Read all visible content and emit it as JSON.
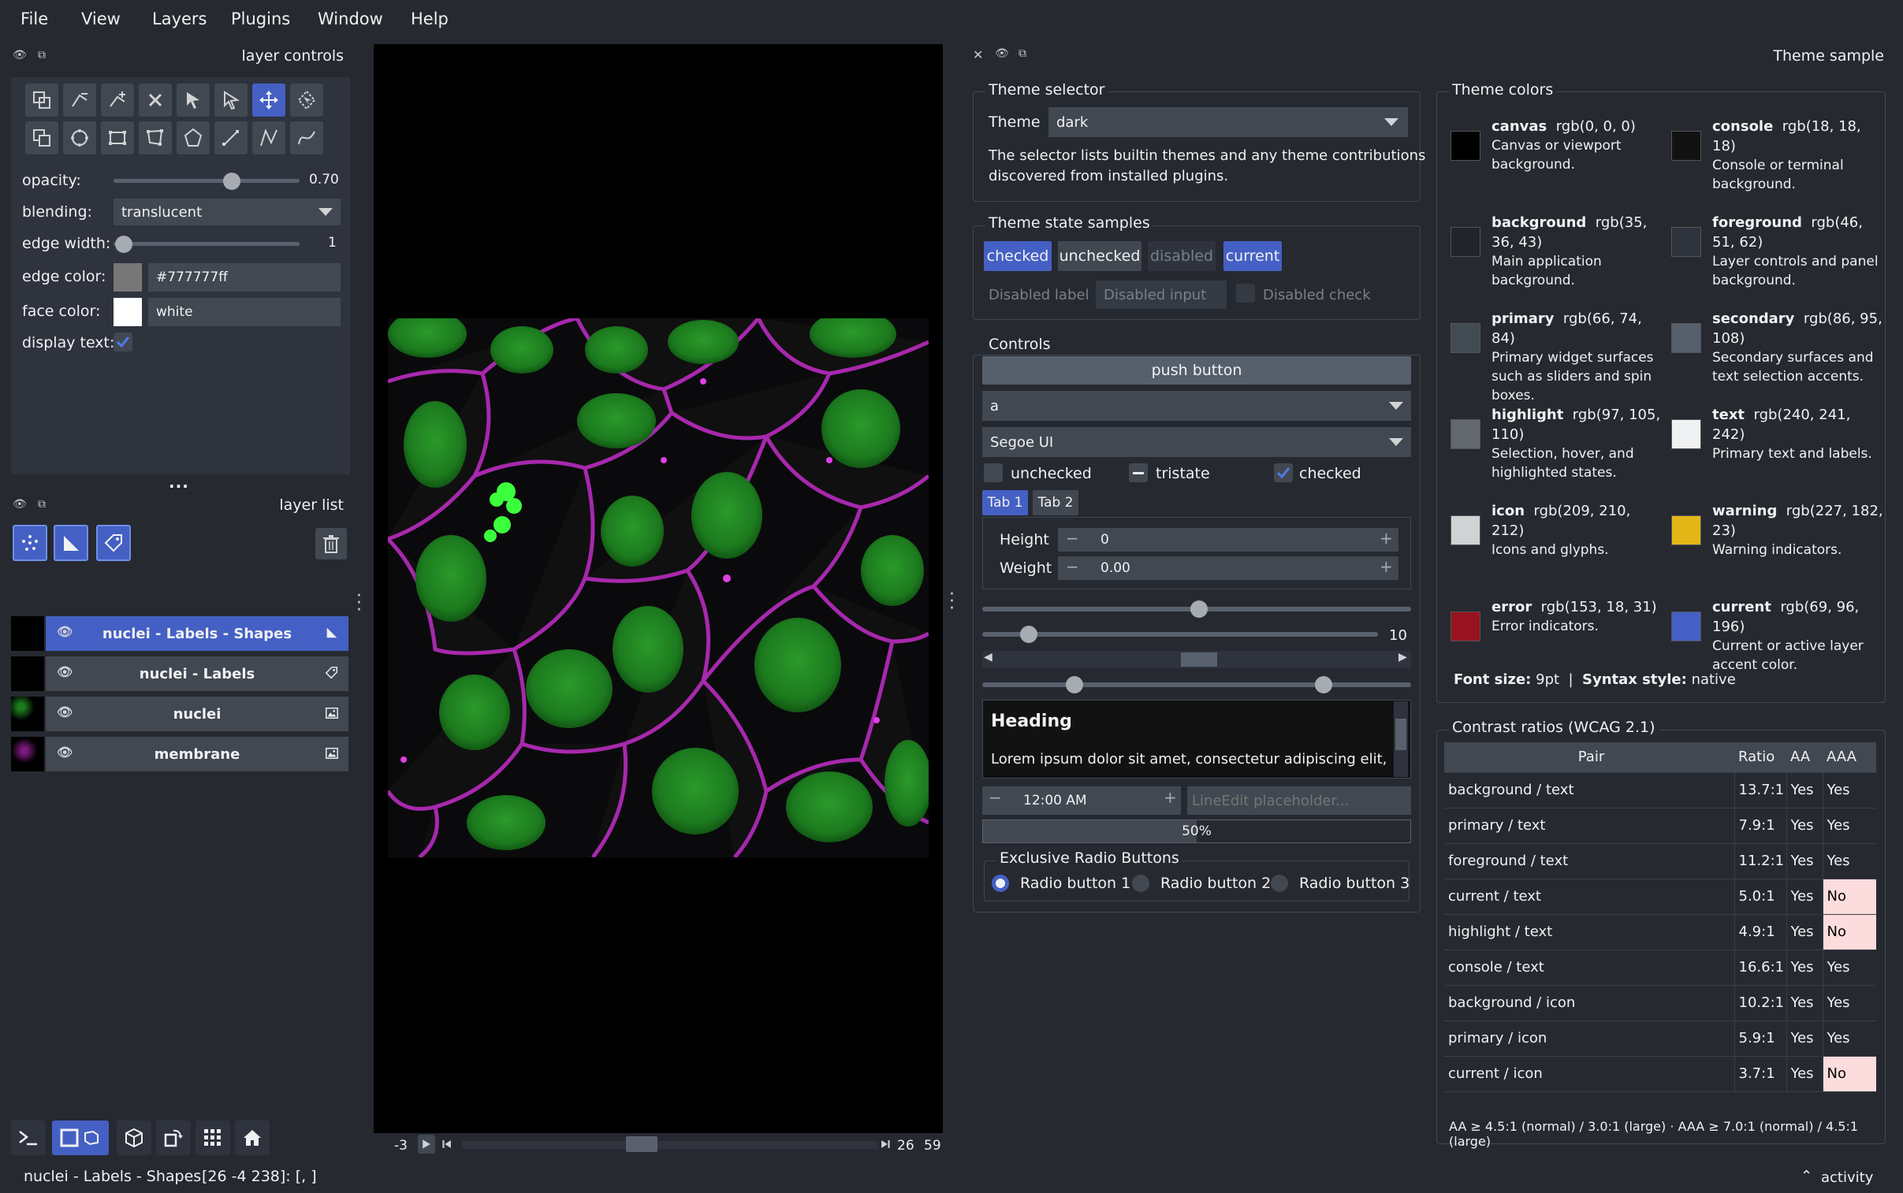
{
  "menu": {
    "file": "File",
    "view": "View",
    "layers": "Layers",
    "plugins": "Plugins",
    "window": "Window",
    "help": "Help"
  },
  "layer_controls": {
    "title": "layer controls",
    "opacity_label": "opacity:",
    "opacity_value": "0.70",
    "opacity": 0.7,
    "blending_label": "blending:",
    "blending_value": "translucent",
    "edge_width_label": "edge width:",
    "edge_width_value": "1",
    "edge_color_label": "edge color:",
    "edge_color_value": "#777777ff",
    "face_color_label": "face color:",
    "face_color_value": "white",
    "display_text_label": "display text:",
    "display_text_checked": true,
    "more": "..."
  },
  "layer_list": {
    "title": "layer list",
    "layers": [
      {
        "name": "nuclei - Labels - Shapes",
        "selected": true,
        "icon": "shapes-icon"
      },
      {
        "name": "nuclei - Labels",
        "selected": false,
        "icon": "labels-icon"
      },
      {
        "name": "nuclei",
        "selected": false,
        "icon": "image-icon"
      },
      {
        "name": "membrane",
        "selected": false,
        "icon": "image-icon"
      }
    ]
  },
  "dims": {
    "left": "-3",
    "frame": "26",
    "total": "59"
  },
  "theme_panel": {
    "title": "Theme sample"
  },
  "theme_selector": {
    "title": "Theme selector",
    "label": "Theme",
    "value": "dark",
    "desc_line1": "The selector lists builtin themes and any theme contributions",
    "desc_line2": "discovered from installed plugins."
  },
  "state_samples": {
    "title": "Theme state samples",
    "checked": "checked",
    "unchecked": "unchecked",
    "disabled": "disabled",
    "current": "current",
    "disabled_label": "Disabled label",
    "disabled_input": "Disabled input",
    "disabled_check": "Disabled check"
  },
  "controls": {
    "title": "Controls",
    "push_button": "push button",
    "combo_value": "a",
    "font_value": "Segoe UI",
    "cb_unchecked": "unchecked",
    "cb_tristate": "tristate",
    "cb_checked": "checked",
    "tab1": "Tab 1",
    "tab2": "Tab 2",
    "height_label": "Height",
    "height_value": "0",
    "weight_label": "Weight",
    "weight_value": "0.00",
    "slider_value": "10",
    "heading": "Heading",
    "lorem": "Lorem ipsum dolor sit amet, consectetur adipiscing elit,",
    "time": "12:00 AM",
    "lineedit_placeholder": "LineEdit placeholder...",
    "progress_text": "50%",
    "progress": 0.5,
    "radio_title": "Exclusive Radio Buttons",
    "radio1": "Radio button 1",
    "radio2": "Radio button 2",
    "radio3": "Radio button 3"
  },
  "theme_colors": {
    "title": "Theme colors",
    "items": [
      {
        "name": "canvas",
        "rgb1": "rgb(0, 0, 0)",
        "rgb2": "",
        "desc": [
          "Canvas or viewport",
          "background."
        ],
        "color": "#000000"
      },
      {
        "name": "console",
        "rgb1": "rgb(18, 18,",
        "rgb2": "18)",
        "desc": [
          "Console or terminal",
          "background."
        ],
        "color": "#121212"
      },
      {
        "name": "background",
        "rgb1": "rgb(35,",
        "rgb2": "36, 43)",
        "desc": [
          "Main application",
          "background."
        ],
        "color": "#23242b"
      },
      {
        "name": "foreground",
        "rgb1": "rgb(46,",
        "rgb2": "51, 62)",
        "desc": [
          "Layer controls and panel",
          "background."
        ],
        "color": "#2e333e"
      },
      {
        "name": "primary",
        "rgb1": "rgb(66, 74,",
        "rgb2": "84)",
        "desc": [
          "Primary widget surfaces",
          "such as sliders and spin",
          "boxes."
        ],
        "color": "#424a54"
      },
      {
        "name": "secondary",
        "rgb1": "rgb(86, 95,",
        "rgb2": "108)",
        "desc": [
          "Secondary surfaces and",
          "text selection accents."
        ],
        "color": "#565f6c"
      },
      {
        "name": "highlight",
        "rgb1": "rgb(97, 105,",
        "rgb2": "110)",
        "desc": [
          "Selection, hover, and",
          "highlighted states."
        ],
        "color": "#61696e"
      },
      {
        "name": "text",
        "rgb1": "rgb(240, 241,",
        "rgb2": "242)",
        "desc": [
          "Primary text and labels."
        ],
        "color": "#f0f1f2"
      },
      {
        "name": "icon",
        "rgb1": "rgb(209, 210,",
        "rgb2": "212)",
        "desc": [
          "Icons and glyphs."
        ],
        "color": "#d1d2d4"
      },
      {
        "name": "warning",
        "rgb1": "rgb(227, 182,",
        "rgb2": "23)",
        "desc": [
          "Warning indicators."
        ],
        "color": "#e3b617"
      },
      {
        "name": "error",
        "rgb1": "rgb(153, 18, 31)",
        "rgb2": "",
        "desc": [
          "Error indicators."
        ],
        "color": "#99121f"
      },
      {
        "name": "current",
        "rgb1": "rgb(69, 96,",
        "rgb2": "196)",
        "desc": [
          "Current or active layer",
          "accent color."
        ],
        "color": "#4560c4"
      }
    ],
    "font_size_label": "Font size:",
    "font_size": "9pt",
    "sep": "|",
    "syntax_label": "Syntax style:",
    "syntax": "native"
  },
  "contrast": {
    "title": "Contrast ratios (WCAG 2.1)",
    "headers": [
      "Pair",
      "Ratio",
      "AA",
      "AAA"
    ],
    "rows": [
      [
        "background / text",
        "13.7:1",
        "Yes",
        "Yes"
      ],
      [
        "primary / text",
        "7.9:1",
        "Yes",
        "Yes"
      ],
      [
        "foreground / text",
        "11.2:1",
        "Yes",
        "Yes"
      ],
      [
        "current / text",
        "5.0:1",
        "Yes",
        "No"
      ],
      [
        "highlight / text",
        "4.9:1",
        "Yes",
        "No"
      ],
      [
        "console / text",
        "16.6:1",
        "Yes",
        "Yes"
      ],
      [
        "background / icon",
        "10.2:1",
        "Yes",
        "Yes"
      ],
      [
        "primary / icon",
        "5.9:1",
        "Yes",
        "Yes"
      ],
      [
        "current / icon",
        "3.7:1",
        "Yes",
        "No"
      ]
    ],
    "footnote": "AA ≥ 4.5:1 (normal) / 3.0:1 (large) · AAA ≥ 7.0:1 (normal) / 4.5:1 (large)"
  },
  "status": {
    "layer": "nuclei - Labels - Shapes",
    "coords": "[26 -4 238]: [, ]",
    "activity": "activity"
  }
}
